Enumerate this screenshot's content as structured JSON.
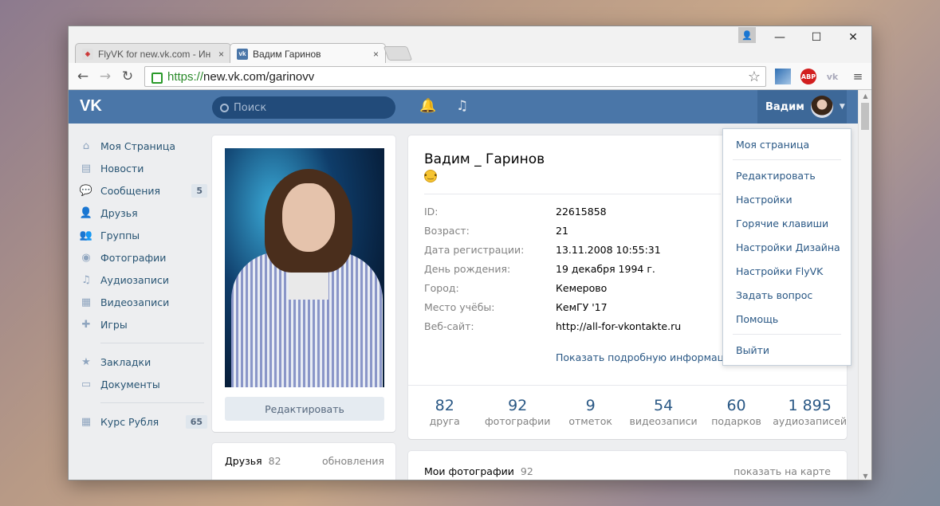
{
  "browser": {
    "tabs": [
      {
        "title": "FlyVK for new.vk.com - Ин",
        "close": "×"
      },
      {
        "title": "Вадим Гаринов",
        "close": "×"
      }
    ],
    "url_scheme": "https://",
    "url_rest": "new.vk.com/garinovv",
    "window_controls": {
      "minimize": "—",
      "maximize": "☐",
      "close": "✕"
    },
    "extensions": [
      "image-ext-icon",
      "adblock-icon",
      "vk-ext-icon",
      "menu-icon"
    ],
    "abp_label": "ABP"
  },
  "vk": {
    "logo": "VK",
    "search_placeholder": "Поиск",
    "user_name": "Вадим",
    "brand_color": "#4a76a8",
    "menu": [
      {
        "label": "Моя Страница",
        "icon": "home-icon"
      },
      {
        "label": "Новости",
        "icon": "news-icon"
      },
      {
        "label": "Сообщения",
        "icon": "messages-icon",
        "badge": "5"
      },
      {
        "label": "Друзья",
        "icon": "friends-icon"
      },
      {
        "label": "Группы",
        "icon": "groups-icon"
      },
      {
        "label": "Фотографии",
        "icon": "camera-icon"
      },
      {
        "label": "Аудиозаписи",
        "icon": "music-icon"
      },
      {
        "label": "Видеозаписи",
        "icon": "video-icon"
      },
      {
        "label": "Игры",
        "icon": "gamepad-icon"
      }
    ],
    "menu2": [
      {
        "label": "Закладки",
        "icon": "star-icon"
      },
      {
        "label": "Документы",
        "icon": "document-icon"
      }
    ],
    "menu3": [
      {
        "label": "Курс Рубля",
        "icon": "apps-icon",
        "badge": "65"
      }
    ],
    "edit_button": "Редактировать",
    "friends_block": {
      "title": "Друзья",
      "count": "82",
      "link": "обновления"
    },
    "profile": {
      "name": "Вадим _ Гаринов",
      "status_emoji": "😐",
      "info": [
        {
          "key": "ID:",
          "value": "22615858",
          "link": false
        },
        {
          "key": "Возраст:",
          "value": "21",
          "link": false
        },
        {
          "key": "Дата регистрации:",
          "value": "13.11.2008 10:55:31",
          "link": false
        },
        {
          "key": "День рождения:",
          "value": "19 декабря 1994 г.",
          "link": true
        },
        {
          "key": "Город:",
          "value": "Кемерово",
          "link": true
        },
        {
          "key": "Место учёбы:",
          "value": "КемГУ '17",
          "link": true
        },
        {
          "key": "Веб-сайт:",
          "value": "http://all-for-vkontakte.ru",
          "link": true
        }
      ],
      "more_link": "Показать подробную информацию",
      "counters": [
        {
          "n": "82",
          "label": "друга"
        },
        {
          "n": "92",
          "label": "фотографии"
        },
        {
          "n": "9",
          "label": "отметок"
        },
        {
          "n": "54",
          "label": "видеозаписи"
        },
        {
          "n": "60",
          "label": "подарков"
        },
        {
          "n": "1 895",
          "label": "аудиозаписей"
        }
      ]
    },
    "photos_block": {
      "title": "Мои фотографии",
      "count": "92",
      "link": "показать на карте"
    },
    "dropdown": {
      "group1": [
        "Моя страница"
      ],
      "group2": [
        "Редактировать",
        "Настройки",
        "Горячие клавиши",
        "Настройки Дизайна",
        "Настройки FlyVK",
        "Задать вопрос",
        "Помощь"
      ],
      "group3": [
        "Выйти"
      ]
    }
  }
}
